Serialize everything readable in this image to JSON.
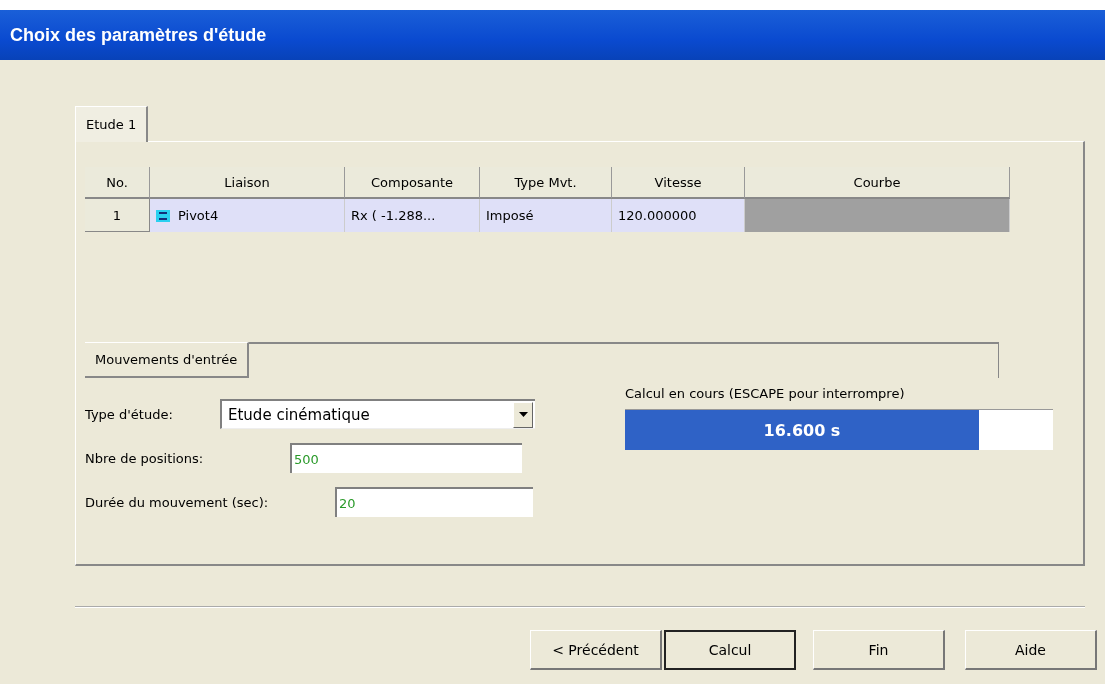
{
  "window": {
    "title": "Choix des paramètres d'étude"
  },
  "tabs": [
    {
      "label": "Etude 1",
      "selected": true
    }
  ],
  "table": {
    "columns": [
      "No.",
      "Liaison",
      "Composante",
      "Type Mvt.",
      "Vitesse",
      "Courbe"
    ],
    "rows": [
      {
        "selected": true,
        "cells": [
          "1",
          "Pivot4",
          "Rx ( -1.288...",
          "Imposé",
          "120.000000"
        ]
      }
    ]
  },
  "section_tabs": [
    {
      "label": "Mouvements d'entrée",
      "selected": true
    }
  ],
  "form": [
    {
      "kind": "dropdown",
      "label": "Type d'étude:",
      "value": "Etude cinématique"
    },
    {
      "kind": "input",
      "label": "Nbre de positions:",
      "value": "500"
    },
    {
      "kind": "input",
      "label": "Durée du mouvement (sec):",
      "value": "20"
    }
  ],
  "progress": {
    "label": "Calcul en cours (ESCAPE pour interrompre)",
    "reading": "16.600 s",
    "level": 0.827
  },
  "buttons": [
    {
      "label": "< Précédent",
      "default": false
    },
    {
      "label": "Calcul",
      "default": true
    },
    {
      "label": "Fin",
      "default": false
    },
    {
      "label": "Aide",
      "default": false
    }
  ]
}
